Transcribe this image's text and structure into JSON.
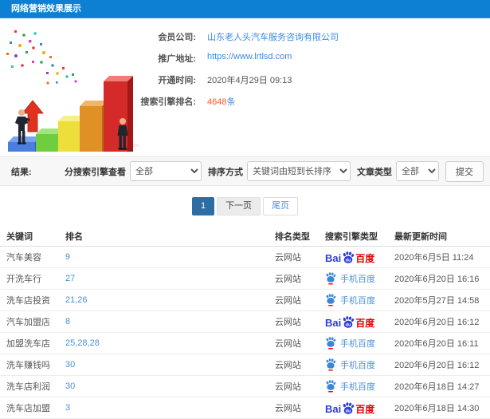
{
  "header": {
    "title": "网络营销效果展示",
    "bar_color": "#0d80d3"
  },
  "info": {
    "rows": [
      {
        "label": "会员公司:",
        "value": "山东老人头汽车服务咨询有限公司"
      },
      {
        "label": "推广地址:",
        "value": "https://www.lrtlsd.com"
      },
      {
        "label": "开通时间:",
        "value": "2020年4月29日 09:13"
      },
      {
        "label": "搜索引擎排名:",
        "number": "4648",
        "unit": "条"
      }
    ]
  },
  "filters": {
    "result_label": "结果:",
    "engine_label": "分搜索引擎查看",
    "engine_value": "全部",
    "sort_label": "排序方式",
    "sort_value": "关键词由短到长排序",
    "article_label": "文章类型",
    "article_value": "全部",
    "submit_label": "提交"
  },
  "pagination": {
    "current": "1",
    "next": "下一页",
    "last": "尾页"
  },
  "table": {
    "headers": [
      "关键词",
      "排名",
      "排名类型",
      "搜索引擎类型",
      "最新更新时间"
    ],
    "engine_labels": {
      "baidu_bai": "Bai",
      "baidu_du": "du",
      "baidu_cn": "百度",
      "mobile": "手机百度"
    },
    "rows": [
      {
        "keyword": "汽车美容",
        "rank": "9",
        "rank_type": "云网站",
        "engine": "baidu",
        "time": "2020年6月5日 11:24"
      },
      {
        "keyword": "开洗车行",
        "rank": "27",
        "rank_type": "云网站",
        "engine": "mobile-baidu",
        "time": "2020年6月20日 16:16"
      },
      {
        "keyword": "洗车店投资",
        "rank": "21,26",
        "rank_type": "云网站",
        "engine": "mobile-baidu",
        "time": "2020年5月27日 14:58"
      },
      {
        "keyword": "汽车加盟店",
        "rank": "8",
        "rank_type": "云网站",
        "engine": "baidu",
        "time": "2020年6月20日 16:12"
      },
      {
        "keyword": "加盟洗车店",
        "rank": "25,28,28",
        "rank_type": "云网站",
        "engine": "mobile-baidu",
        "time": "2020年6月20日 16:11"
      },
      {
        "keyword": "洗车赚钱吗",
        "rank": "30",
        "rank_type": "云网站",
        "engine": "mobile-baidu",
        "time": "2020年6月20日 16:12"
      },
      {
        "keyword": "洗车店利润",
        "rank": "30",
        "rank_type": "云网站",
        "engine": "mobile-baidu",
        "time": "2020年6月18日 14:27"
      },
      {
        "keyword": "洗车店加盟",
        "rank": "3",
        "rank_type": "云网站",
        "engine": "baidu",
        "time": "2020年6月18日 14:30"
      }
    ]
  },
  "colors": {
    "link_blue": "#3a8be0",
    "rank_blue": "#4a90d9",
    "count_orange": "#ff5722",
    "baidu_blue": "#2b3ed9",
    "baidu_red": "#e60000",
    "page_active": "#2e6da4"
  }
}
